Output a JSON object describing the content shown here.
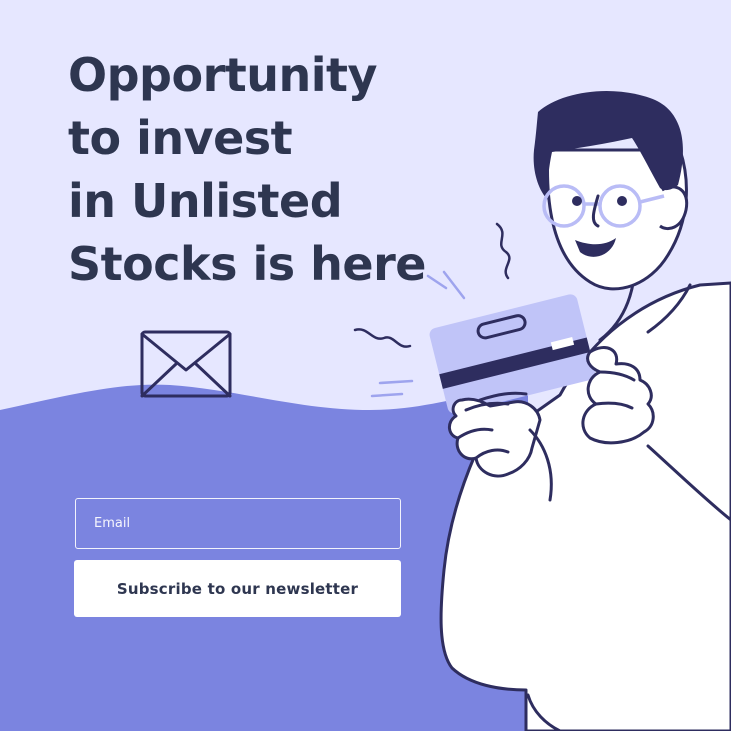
{
  "hero": {
    "headline_lines": [
      "Opportunity",
      "to invest",
      "in Unlisted",
      "Stocks is here"
    ]
  },
  "newsletter": {
    "email_placeholder": "Email",
    "email_value": "",
    "subscribe_label": "Subscribe to our newsletter"
  },
  "colors": {
    "background": "#e6e7ff",
    "wave": "#7b84e0",
    "headline": "#2e3650",
    "ink": "#2e2d5f",
    "card": "#c0c4f8"
  },
  "icons": {
    "envelope": "envelope-icon"
  }
}
